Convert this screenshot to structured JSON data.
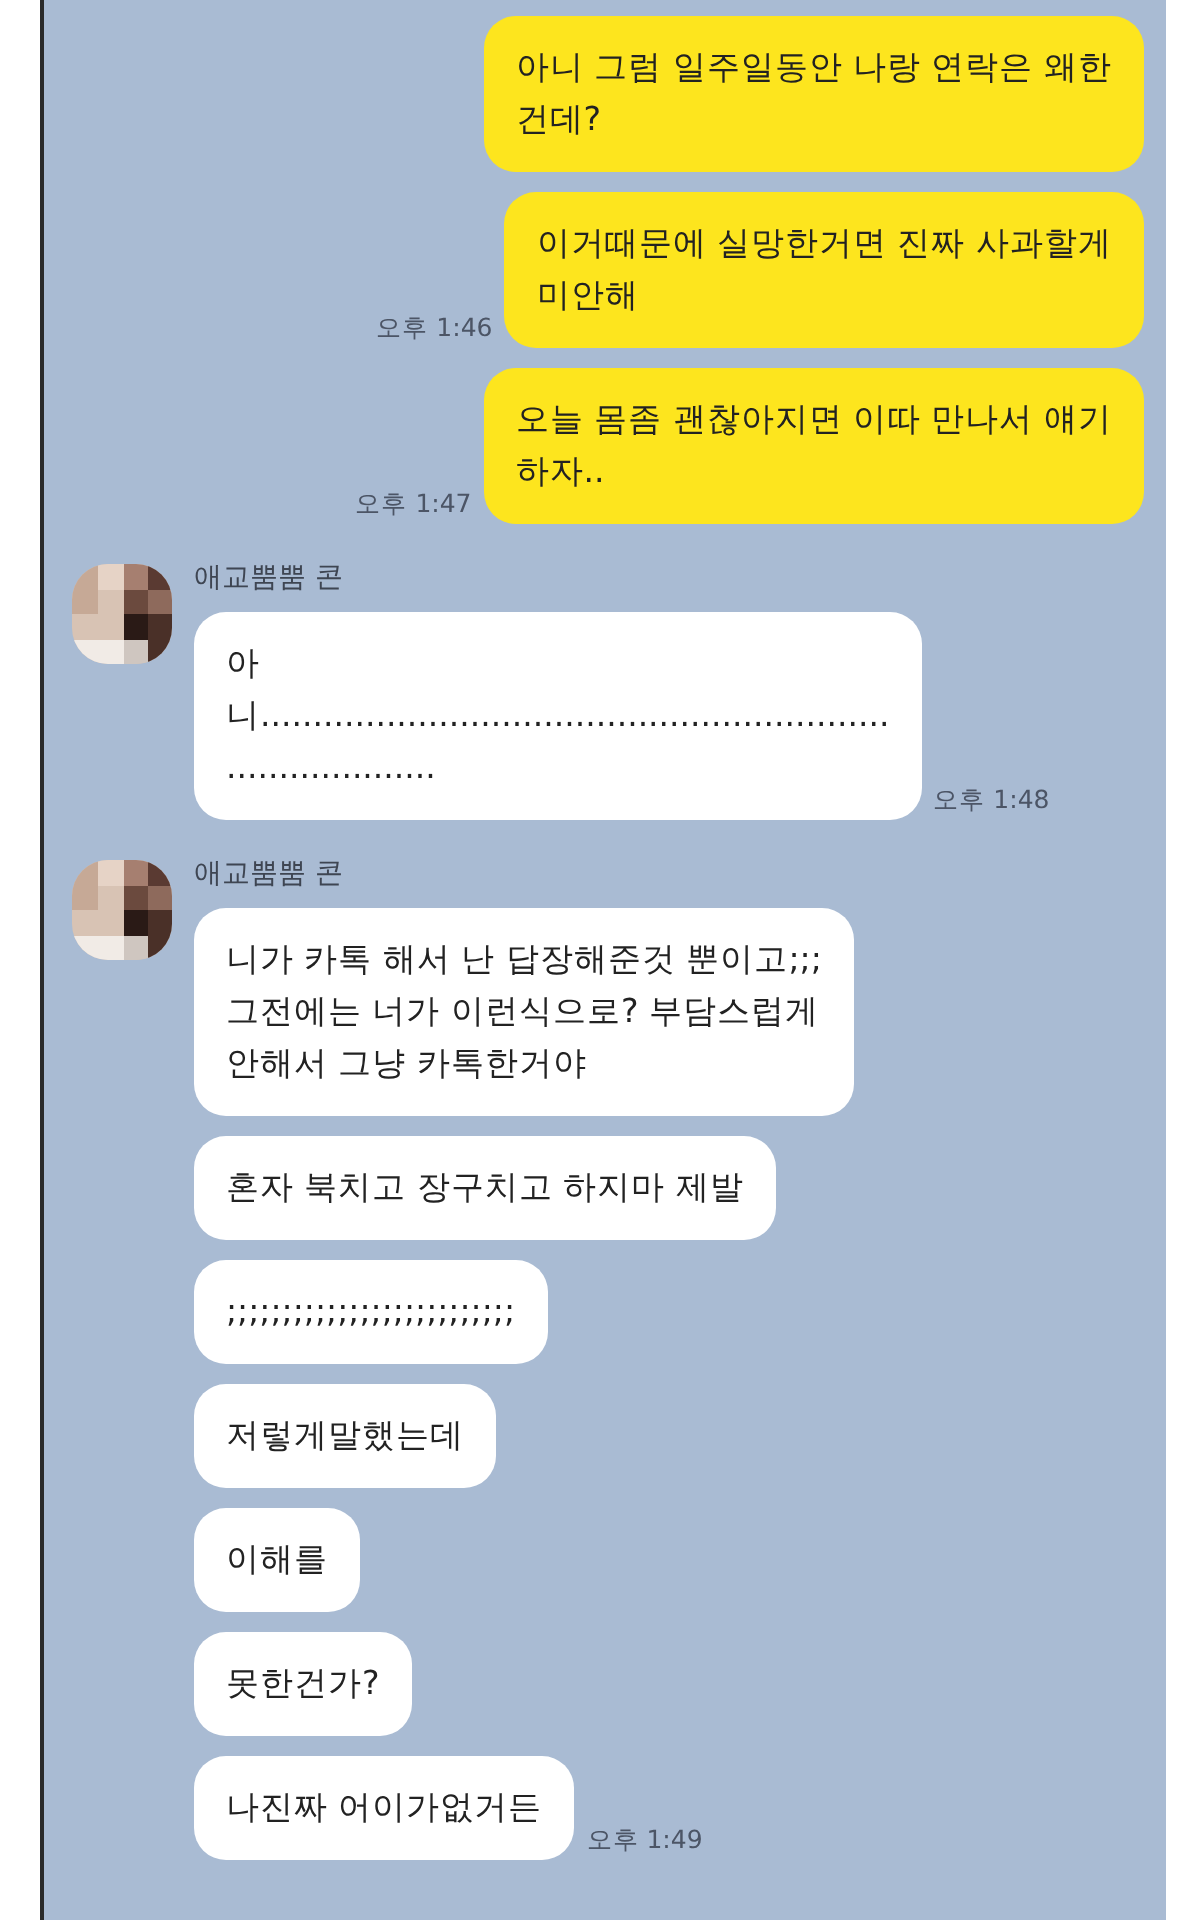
{
  "groups": [
    {
      "kind": "sent",
      "messages": [
        {
          "text": "아니 그럼 일주일동안 나랑 연락은 왜한\n건데?"
        },
        {
          "text": "이거때문에 실망한거면 진짜 사과할게\n미안해",
          "time": "오후 1:46"
        },
        {
          "text": "오늘 몸좀 괜찮아지면 이따 만나서 얘기\n하자..",
          "time": "오후 1:47"
        }
      ]
    },
    {
      "kind": "received",
      "name": "애교뿜뿜 콘",
      "messages": [
        {
          "text": "아\n니............................................................\n....................",
          "time": "오후 1:48"
        }
      ]
    },
    {
      "kind": "received",
      "name": "애교뿜뿜 콘",
      "messages": [
        {
          "text": "니가 카톡 해서 난 답장해준것 뿐이고;;;\n그전에는 너가 이런식으로? 부담스럽게\n안해서 그냥 카톡한거야"
        },
        {
          "text": "혼자 북치고 장구치고 하지마 제발"
        },
        {
          "text": ";;;;;;;;;;;;;;;;;;;;;;;;;;"
        },
        {
          "text": "저렇게말했는데"
        },
        {
          "text": "이해를"
        },
        {
          "text": "못한건가?"
        },
        {
          "text": "나진짜 어이가없거든",
          "time": "오후 1:49"
        }
      ]
    }
  ]
}
